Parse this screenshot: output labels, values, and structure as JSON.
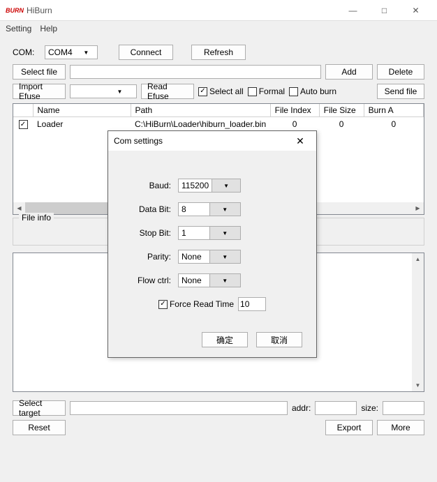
{
  "window": {
    "logo": "BURN",
    "title": "HiBurn"
  },
  "menu": {
    "setting": "Setting",
    "help": "Help"
  },
  "toolbar": {
    "com_label": "COM:",
    "com_value": "COM4",
    "connect": "Connect",
    "refresh": "Refresh",
    "select_file": "Select file",
    "add": "Add",
    "delete": "Delete",
    "import_efuse": "Import Efuse",
    "read_efuse": "Read Efuse",
    "select_all": "Select all",
    "formal": "Formal",
    "auto_burn": "Auto burn",
    "send_file": "Send file"
  },
  "table": {
    "headers": {
      "name": "Name",
      "path": "Path",
      "file_index": "File Index",
      "file_size": "File Size",
      "burn_addr": "Burn A"
    },
    "rows": [
      {
        "checked": true,
        "name": "Loader",
        "path": "C:\\HiBurn\\Loader\\hiburn_loader.bin",
        "file_index": "0",
        "file_size": "0",
        "burn_addr": "0"
      }
    ]
  },
  "file_info_label": "File info",
  "bottom": {
    "select_target": "Select target",
    "addr_label": "addr:",
    "size_label": "size:",
    "reset": "Reset",
    "export": "Export",
    "more": "More"
  },
  "dialog": {
    "title": "Com settings",
    "baud_label": "Baud:",
    "baud_value": "115200",
    "databit_label": "Data Bit:",
    "databit_value": "8",
    "stopbit_label": "Stop Bit:",
    "stopbit_value": "1",
    "parity_label": "Parity:",
    "parity_value": "None",
    "flow_label": "Flow ctrl:",
    "flow_value": "None",
    "force_read_label": "Force Read Time",
    "force_read_value": "10",
    "ok": "确定",
    "cancel": "取消"
  }
}
